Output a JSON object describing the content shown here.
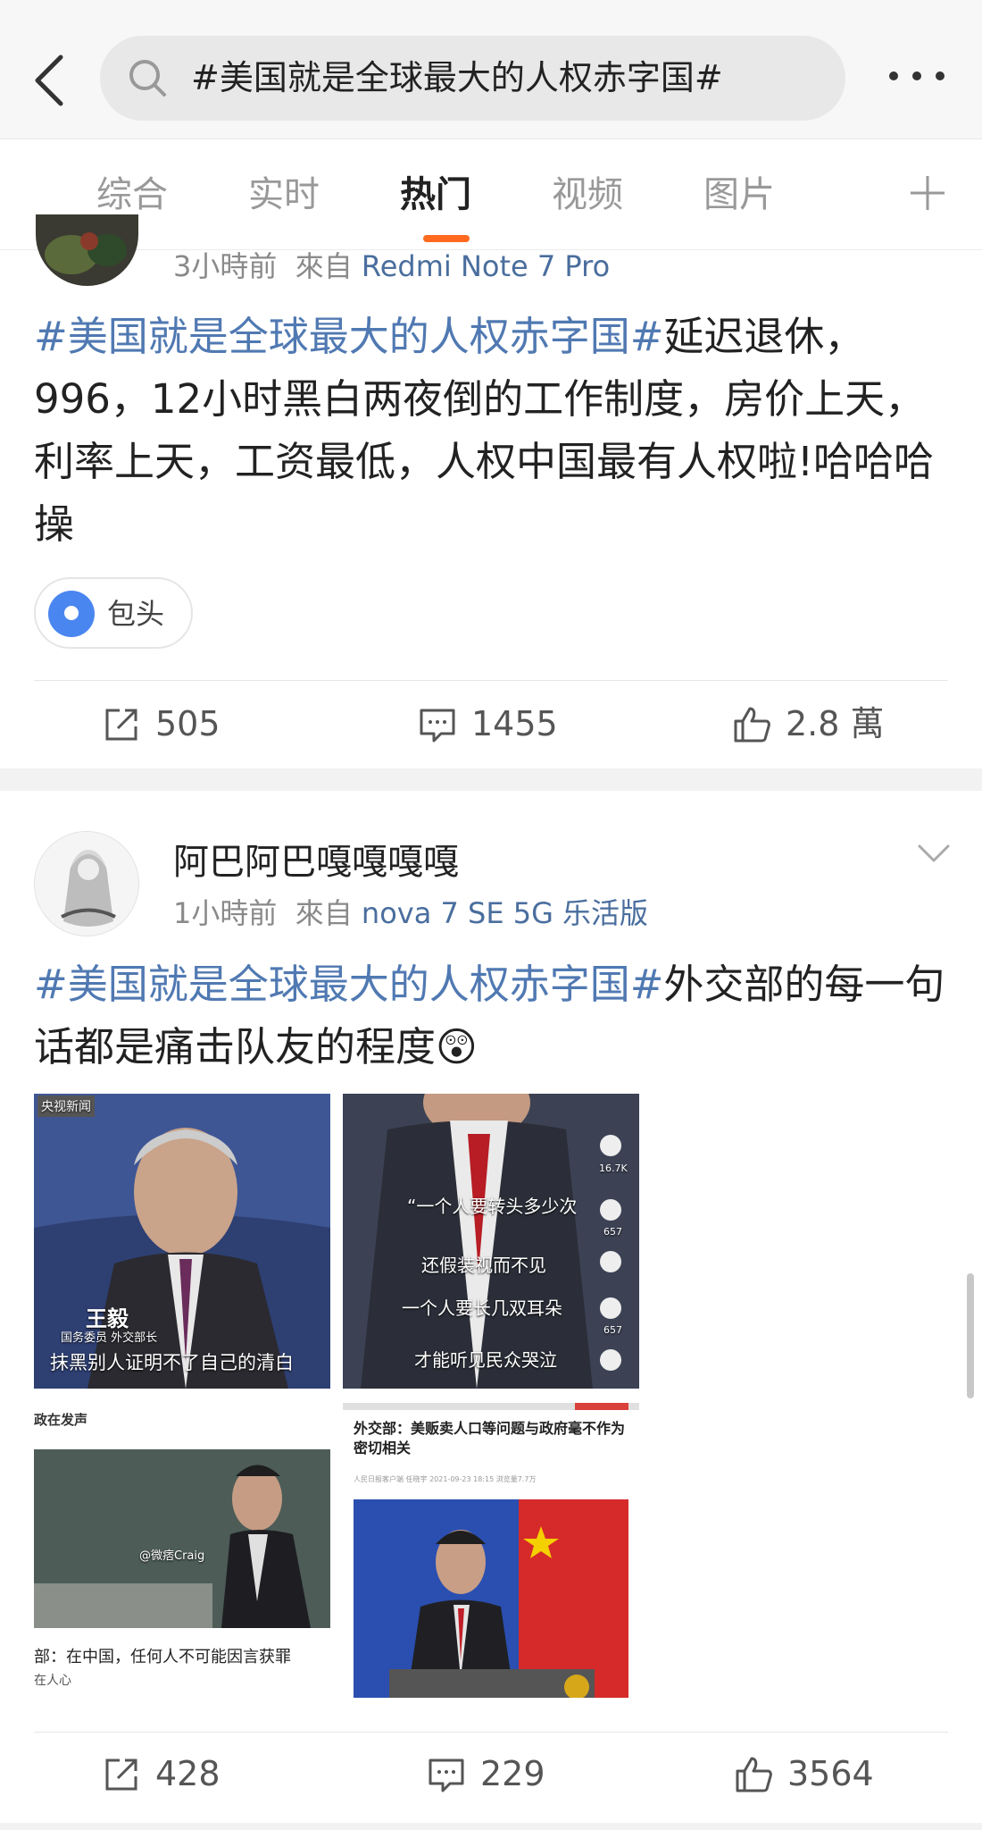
{
  "search": {
    "query": "#美国就是全球最大的人权赤字国#"
  },
  "tabs": [
    "综合",
    "实时",
    "热门",
    "视频",
    "图片"
  ],
  "post1": {
    "time": "3小時前",
    "from_prefix": "來自",
    "source": "Redmi Note 7 Pro",
    "hashtag": "#美国就是全球最大的人权赤字国#",
    "text": "延迟退休，996，12小时黑白两夜倒的工作制度，房价上天，利率上天，工资最低，人权中国最有人权啦!哈哈哈操",
    "location": "包头",
    "reposts": "505",
    "comments": "1455",
    "likes": "2.8 萬"
  },
  "post2": {
    "author": "阿巴阿巴嘎嘎嘎嘎",
    "time": "1小時前",
    "from_prefix": "來自",
    "source": "nova 7 SE 5G 乐活版",
    "hashtag": "#美国就是全球最大的人权赤字国#",
    "text": "外交部的每一句话都是痛击队友的程度",
    "emoji": "😲",
    "photos": {
      "p1_name": "王毅",
      "p1_title": "国务委员 外交部长",
      "p1_caption": "抹黑别人证明不了自己的清白",
      "p1_logo": "央视新闻",
      "p2_lines": [
        "“一个人要转头多少次",
        "还假装视而不见",
        "一个人要长几双耳朵",
        "才能听见民众哭泣"
      ],
      "p2_counts": [
        "16.7K",
        "657",
        "657"
      ],
      "p3_top": "政在发声",
      "p3_watermark": "@微痞Craig",
      "p3_caption": "部：在中国，任何人不可能因言获罪",
      "p3_sub": "在人心",
      "p4_headline": "外交部：美贩卖人口等问题与政府毫不作为密切相关",
      "p4_meta": "人民日报客户端  任晓宇  2021-09-23 18:15  浏览量7.7万"
    },
    "reposts": "428",
    "comments": "229",
    "likes": "3564"
  },
  "colors": {
    "accent": "#ff6a1f",
    "link": "#5079b2",
    "location": "#4a86f0"
  },
  "icons": [
    "back-arrow-icon",
    "search-icon",
    "more-icon",
    "plus-icon",
    "location-pin-icon",
    "repost-icon",
    "comment-icon",
    "like-icon",
    "chevron-down-icon"
  ]
}
